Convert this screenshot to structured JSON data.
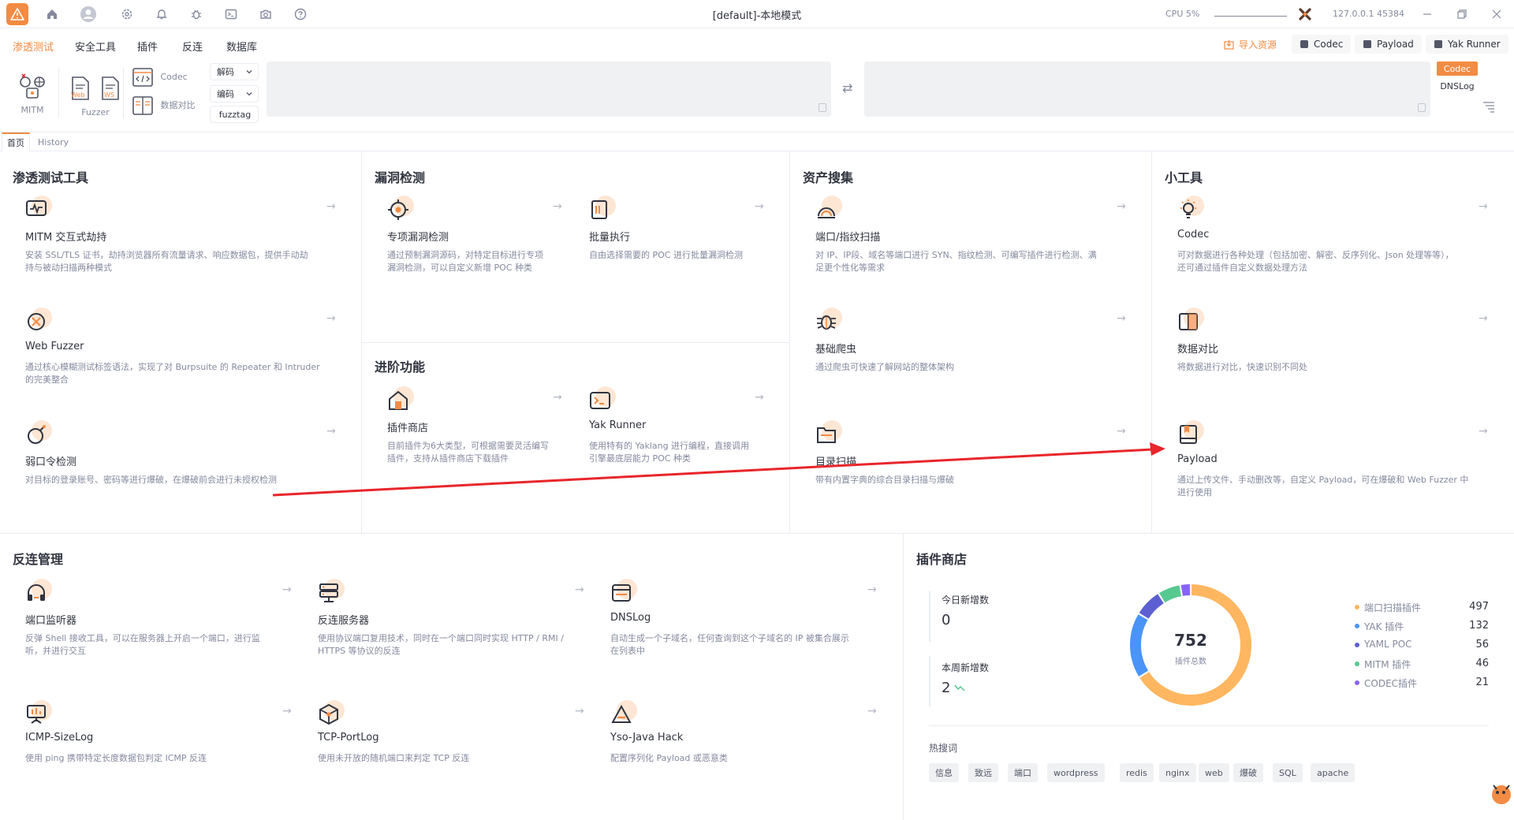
{
  "titlebar": {
    "title": "[default]-本地模式",
    "cpu": "CPU 5%",
    "address": "127.0.0.1 45384",
    "icons": [
      "home-icon",
      "user-icon",
      "gear-icon",
      "bell-icon",
      "bug-icon",
      "terminal-icon",
      "camera-icon",
      "help-icon"
    ]
  },
  "menu": {
    "items": [
      "渗透测试",
      "安全工具",
      "插件",
      "反连",
      "数据库"
    ],
    "import": "导入资源",
    "codec": "Codec",
    "payload": "Payload",
    "yak_runner": "Yak Runner"
  },
  "toolbar": {
    "mitm": "MITM",
    "fuzzer": "Fuzzer",
    "web": "Web",
    "ws": "WS",
    "codec": "Codec",
    "compare": "数据对比",
    "decode": "解码",
    "encode": "编码",
    "fuzztag": "fuzztag",
    "side_codec": "Codec",
    "side_dnslog": "DNSLog"
  },
  "tabs": [
    "首页",
    "History"
  ],
  "sections": {
    "pentest": {
      "title": "渗透测试工具",
      "cards": [
        {
          "name": "MITM 交互式劫持",
          "desc1": "安装 SSL/TLS 证书，劫持浏览器所有流量请求、响应数据包，提供手动劫",
          "desc2": "持与被动扫描两种模式"
        },
        {
          "name": "Web Fuzzer",
          "desc1": "通过核心模糊测试标签语法，实现了对 Burpsuite 的 Repeater 和 Intruder",
          "desc2": "的完美整合"
        },
        {
          "name": "弱口令检测",
          "desc1": "对目标的登录账号、密码等进行爆破，在爆破前会进行未授权检测",
          "desc2": ""
        }
      ]
    },
    "vuln": {
      "title": "漏洞检测",
      "cards": [
        {
          "name": "专项漏洞检测",
          "desc1": "通过预制漏洞源码，对特定目标进行专项",
          "desc2": "漏洞检测，可以自定义新增 POC 种类"
        },
        {
          "name": "批量执行",
          "desc1": "自由选择需要的 POC 进行批量漏洞检测",
          "desc2": ""
        }
      ]
    },
    "advanced": {
      "title": "进阶功能",
      "cards": [
        {
          "name": "插件商店",
          "desc1": "目前插件为6大类型，可根据需要灵活编写",
          "desc2": "插件，支持从插件商店下载插件"
        },
        {
          "name": "Yak Runner",
          "desc1": "使用特有的 Yaklang 进行编程，直接调用",
          "desc2": "引擎最底层能力 POC 种类"
        }
      ]
    },
    "asset": {
      "title": "资产搜集",
      "cards": [
        {
          "name": "端口/指纹扫描",
          "desc1": "对 IP、IP段、域名等端口进行 SYN、指纹检测、可编写插件进行检测、满",
          "desc2": "足更个性化等需求"
        },
        {
          "name": "基础爬虫",
          "desc1": "通过爬虫可快速了解网站的整体架构",
          "desc2": ""
        },
        {
          "name": "目录扫描",
          "desc1": "带有内置字典的综合目录扫描与爆破",
          "desc2": ""
        }
      ]
    },
    "tools": {
      "title": "小工具",
      "cards": [
        {
          "name": "Codec",
          "desc1": "可对数据进行各种处理（包括加密、解密、反序列化、Json 处理等等），",
          "desc2": "还可通过插件自定义数据处理方法"
        },
        {
          "name": "数据对比",
          "desc1": "将数据进行对比，快速识别不同处",
          "desc2": ""
        },
        {
          "name": "Payload",
          "desc1": "通过上传文件、手动删改等，自定义 Payload，可在爆破和 Web Fuzzer 中",
          "desc2": "进行使用"
        }
      ]
    },
    "reverse": {
      "title": "反连管理",
      "cards": [
        {
          "name": "端口监听器",
          "desc1": "反弹 Shell 接收工具，可以在服务器上开启一个端口，进行监",
          "desc2": "听，并进行交互"
        },
        {
          "name": "反连服务器",
          "desc1": "使用协议端口复用技术，同时在一个端口同时实现 HTTP / RMI /",
          "desc2": "HTTPS 等协议的反连"
        },
        {
          "name": "DNSLog",
          "desc1": "自动生成一个子域名，任何查询到这个子域名的 IP 被集合展示",
          "desc2": "在列表中"
        },
        {
          "name": "ICMP-SizeLog",
          "desc1": "使用 ping 携带特定长度数据包判定 ICMP 反连",
          "desc2": ""
        },
        {
          "name": "TCP-PortLog",
          "desc1": "使用未开放的随机端口来判定 TCP 反连",
          "desc2": ""
        },
        {
          "name": "Yso-Java Hack",
          "desc1": "配置序列化 Payload 或恶意类",
          "desc2": ""
        }
      ]
    },
    "store": {
      "title": "插件商店",
      "today_label": "今日新增数",
      "today_value": "0",
      "week_label": "本周新增数",
      "week_value": "2",
      "total": "752",
      "total_label": "插件总数",
      "legend": [
        {
          "name": "端口扫描插件",
          "value": "497",
          "color": "#ffb660"
        },
        {
          "name": "YAK 插件",
          "value": "132",
          "color": "#4a94f8"
        },
        {
          "name": "YAML POC",
          "value": "56",
          "color": "#5b5fd1"
        },
        {
          "name": "MITM 插件",
          "value": "46",
          "color": "#56c991"
        },
        {
          "name": "CODEC插件",
          "value": "21",
          "color": "#8863f7"
        }
      ],
      "hot_label": "热搜词",
      "hot": [
        "信息",
        "致远",
        "端口",
        "wordpress",
        "redis",
        "nginx",
        "web",
        "爆破",
        "SQL",
        "apache"
      ]
    }
  },
  "colors": {
    "accent": "#f28b44",
    "annotation": "#e8262b"
  }
}
